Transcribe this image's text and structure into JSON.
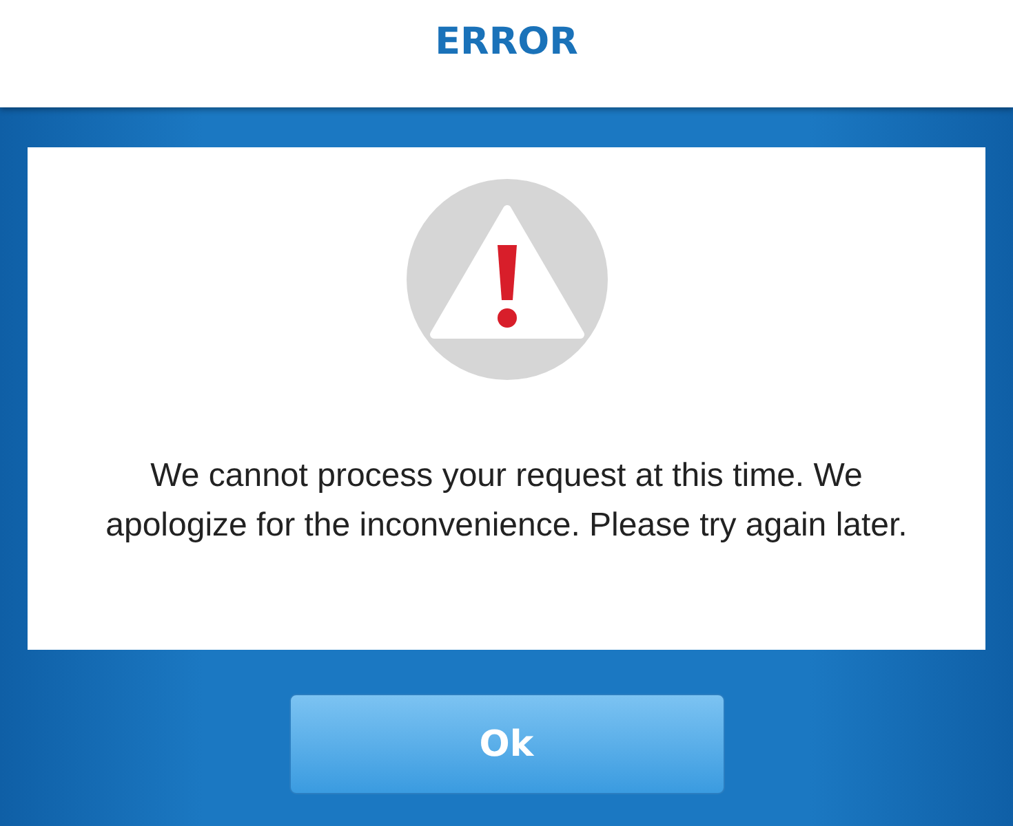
{
  "header": {
    "title": "ERROR"
  },
  "dialog": {
    "message": "We cannot process your request at this time. We apologize for the inconvenience. Please try again later."
  },
  "buttons": [
    {
      "label": "Ok"
    }
  ]
}
